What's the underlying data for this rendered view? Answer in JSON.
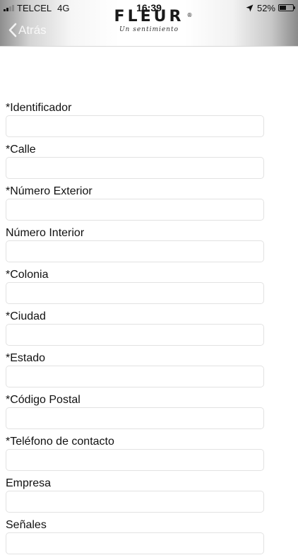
{
  "status_bar": {
    "carrier": "TELCEL",
    "network": "4G",
    "time": "16:39",
    "battery": "52%",
    "battery_level": 0.52
  },
  "nav": {
    "back_label": "Atrás",
    "brand": "FLEUR",
    "brand_mark": "®",
    "tagline": "Un sentimiento"
  },
  "form": {
    "fields": [
      {
        "label": "*Identificador",
        "value": ""
      },
      {
        "label": "*Calle",
        "value": ""
      },
      {
        "label": "*Número Exterior",
        "value": ""
      },
      {
        "label": "Número Interior",
        "value": ""
      },
      {
        "label": "*Colonia",
        "value": ""
      },
      {
        "label": "*Ciudad",
        "value": ""
      },
      {
        "label": "*Estado",
        "value": ""
      },
      {
        "label": "*Código Postal",
        "value": ""
      },
      {
        "label": "*Teléfono de contacto",
        "value": ""
      },
      {
        "label": "Empresa",
        "value": ""
      },
      {
        "label": "Señales",
        "value": ""
      }
    ]
  },
  "icons": {
    "signal": "signal-strength-icon",
    "location": "location-arrow-icon",
    "battery": "battery-icon",
    "back": "chevron-left-icon"
  }
}
